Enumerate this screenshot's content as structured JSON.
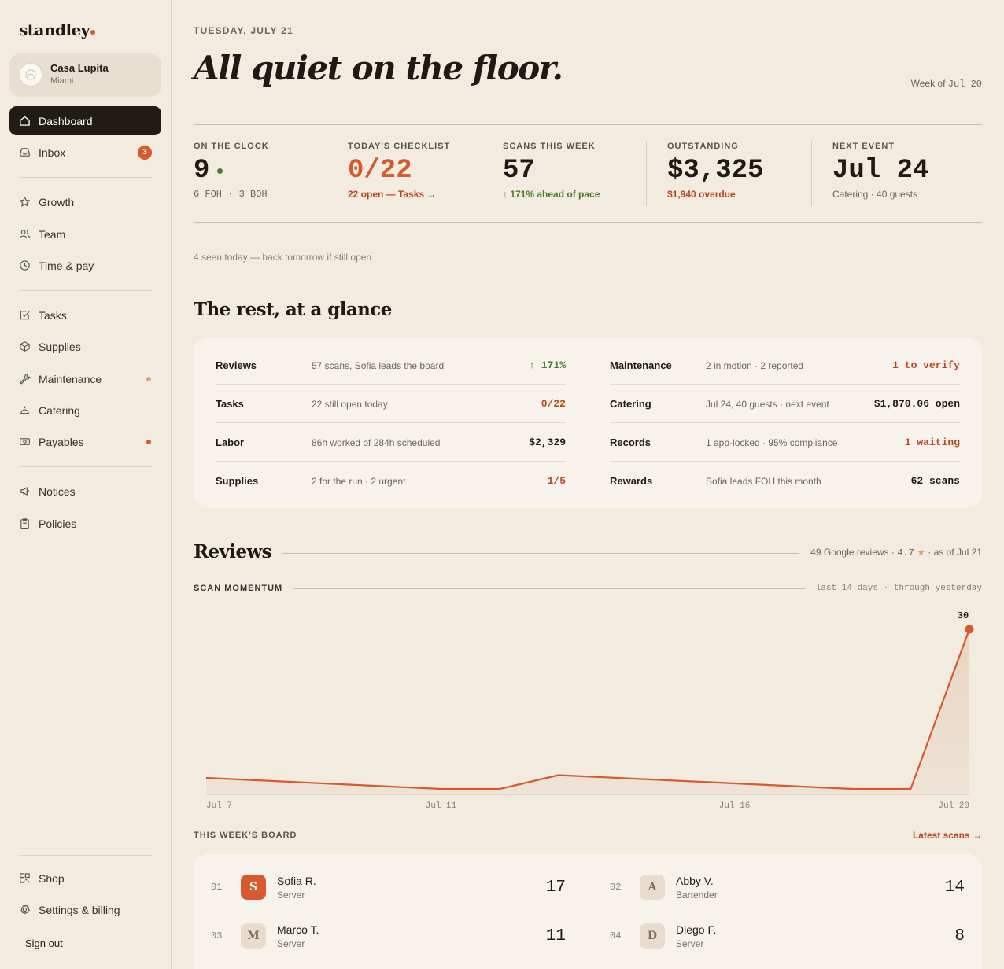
{
  "brand": {
    "name": "standley"
  },
  "venue": {
    "name": "Casa Lupita",
    "city": "Miami"
  },
  "nav": {
    "dashboard": "Dashboard",
    "inbox": "Inbox",
    "inbox_badge": "3",
    "growth": "Growth",
    "team": "Team",
    "time_pay": "Time & pay",
    "tasks": "Tasks",
    "supplies": "Supplies",
    "maintenance": "Maintenance",
    "catering": "Catering",
    "payables": "Payables",
    "notices": "Notices",
    "policies": "Policies",
    "shop": "Shop",
    "settings": "Settings & billing",
    "sign_out": "Sign out"
  },
  "colors": {
    "accent": "#d65a2e",
    "dark": "#221c17",
    "positive": "#4e7a2a",
    "background": "#f2ebe0"
  },
  "header": {
    "date": "TUESDAY, JULY 21",
    "headline": "All quiet on the floor.",
    "week_prefix": "Week of",
    "week_date": "Jul 20"
  },
  "stats": [
    {
      "label": "ON THE CLOCK",
      "value": "9",
      "sub": "6 FOH · 3 BOH"
    },
    {
      "label": "TODAY'S CHECKLIST",
      "value": "0/22",
      "sub": "22 open — Tasks →"
    },
    {
      "label": "SCANS THIS WEEK",
      "value": "57",
      "sub": "↑ 171% ahead of pace"
    },
    {
      "label": "OUTSTANDING",
      "value": "$3,325",
      "sub": "$1,940 overdue"
    },
    {
      "label": "NEXT EVENT",
      "value": "Jul 24",
      "sub": "Catering · 40 guests"
    }
  ],
  "seen_note": "4 seen today — back tomorrow if still open.",
  "glance": {
    "title": "The rest, at a glance",
    "left": [
      {
        "name": "Reviews",
        "desc": "57 scans, Sofia leads the board",
        "value": "↑ 171%"
      },
      {
        "name": "Tasks",
        "desc": "22 still open today",
        "value": "0/22"
      },
      {
        "name": "Labor",
        "desc": "86h worked of 284h scheduled",
        "value": "$2,329"
      },
      {
        "name": "Supplies",
        "desc": "2 for the run · 2 urgent",
        "value": "1/5"
      }
    ],
    "right": [
      {
        "name": "Maintenance",
        "desc": "2 in motion · 2 reported",
        "value": "1 to verify"
      },
      {
        "name": "Catering",
        "desc": "Jul 24, 40 guests · next event",
        "value": "$1,870.06 open"
      },
      {
        "name": "Records",
        "desc": "1 app-locked · 95% compliance",
        "value": "1 waiting"
      },
      {
        "name": "Rewards",
        "desc": "Sofia leads FOH this month",
        "value": "62 scans"
      }
    ]
  },
  "reviews": {
    "title": "Reviews",
    "meta_count": "49 Google reviews ·",
    "meta_rating": "4.7",
    "meta_star": "★",
    "meta_asof": "· as of Jul 21",
    "momentum_label": "SCAN MOMENTUM",
    "momentum_meta": "last 14 days · through yesterday"
  },
  "chart_data": {
    "type": "area",
    "x": [
      "Jul 7",
      "Jul 8",
      "Jul 9",
      "Jul 10",
      "Jul 11",
      "Jul 12",
      "Jul 13",
      "Jul 14",
      "Jul 15",
      "Jul 16",
      "Jul 17",
      "Jul 18",
      "Jul 19",
      "Jul 20"
    ],
    "values": [
      3,
      2.5,
      2,
      1.5,
      1,
      1,
      3.5,
      3,
      2.5,
      2,
      1.5,
      1,
      1,
      30
    ],
    "x_tick_labels": [
      "Jul 7",
      "Jul 11",
      "Jul 16",
      "Jul 20"
    ],
    "last_value_label": "30",
    "ylim": [
      0,
      30
    ],
    "grid": false
  },
  "board": {
    "title": "THIS WEEK'S BOARD",
    "link": "Latest scans →",
    "entries": [
      {
        "rank": "01",
        "initial": "S",
        "name": "Sofia R.",
        "role": "Server",
        "score": "17"
      },
      {
        "rank": "02",
        "initial": "A",
        "name": "Abby V.",
        "role": "Bartender",
        "score": "14"
      },
      {
        "rank": "03",
        "initial": "M",
        "name": "Marco T.",
        "role": "Server",
        "score": "11"
      },
      {
        "rank": "04",
        "initial": "D",
        "name": "Diego F.",
        "role": "Server",
        "score": "8"
      }
    ]
  }
}
